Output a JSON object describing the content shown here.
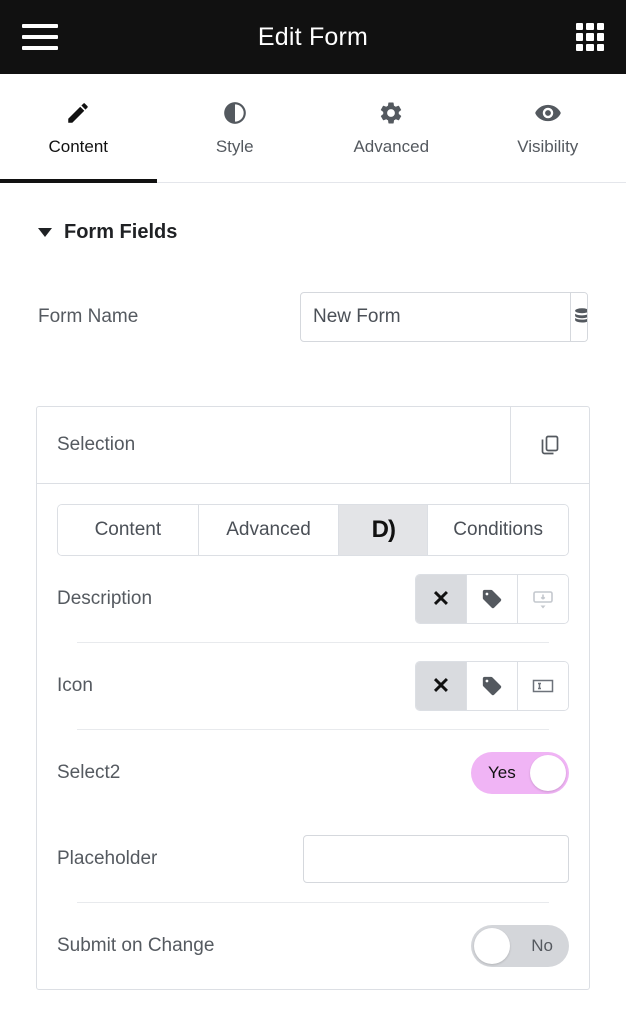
{
  "header": {
    "title": "Edit Form",
    "menu_icon": "hamburger-menu-icon",
    "apps_icon": "grid-apps-icon"
  },
  "main_tabs": [
    {
      "label": "Content",
      "icon": "pencil-icon",
      "active": true
    },
    {
      "label": "Style",
      "icon": "contrast-icon",
      "active": false
    },
    {
      "label": "Advanced",
      "icon": "gear-icon",
      "active": false
    },
    {
      "label": "Visibility",
      "icon": "eye-icon",
      "active": false
    }
  ],
  "section": {
    "title": "Form Fields",
    "expanded": true
  },
  "form_name": {
    "label": "Form Name",
    "value": "New Form",
    "placeholder": "",
    "addon_icon": "database-stack-icon"
  },
  "field_card": {
    "title": "Selection",
    "copy_icon": "duplicate-icon",
    "inner_tabs": [
      {
        "label": "Content",
        "active": false
      },
      {
        "label": "Advanced",
        "active": false
      },
      {
        "label": "D)",
        "active": true,
        "icon": "dynamic-logo-icon"
      },
      {
        "label": "Conditions",
        "active": false
      }
    ],
    "rows": [
      {
        "label": "Description",
        "type": "button-group",
        "buttons": [
          {
            "icon": "close-x-icon",
            "active": true
          },
          {
            "icon": "tag-icon",
            "active": false
          },
          {
            "icon": "tooltip-icon",
            "active": false
          }
        ]
      },
      {
        "label": "Icon",
        "type": "button-group",
        "buttons": [
          {
            "icon": "close-x-icon",
            "active": true
          },
          {
            "icon": "tag-icon",
            "active": false
          },
          {
            "icon": "input-field-icon",
            "active": false
          }
        ]
      },
      {
        "label": "Select2",
        "type": "switch",
        "state": "on",
        "state_label": "Yes"
      },
      {
        "label": "Placeholder",
        "type": "text-input",
        "value": "",
        "placeholder": ""
      },
      {
        "label": "Submit on Change",
        "type": "switch",
        "state": "off",
        "state_label": "No"
      }
    ]
  },
  "colors": {
    "header_bg": "#111111",
    "switch_on": "#f0b4f5",
    "switch_off": "#d4d6da",
    "active_seg": "#e3e4e7",
    "text": "#555a60",
    "border": "#dcdfe4"
  }
}
